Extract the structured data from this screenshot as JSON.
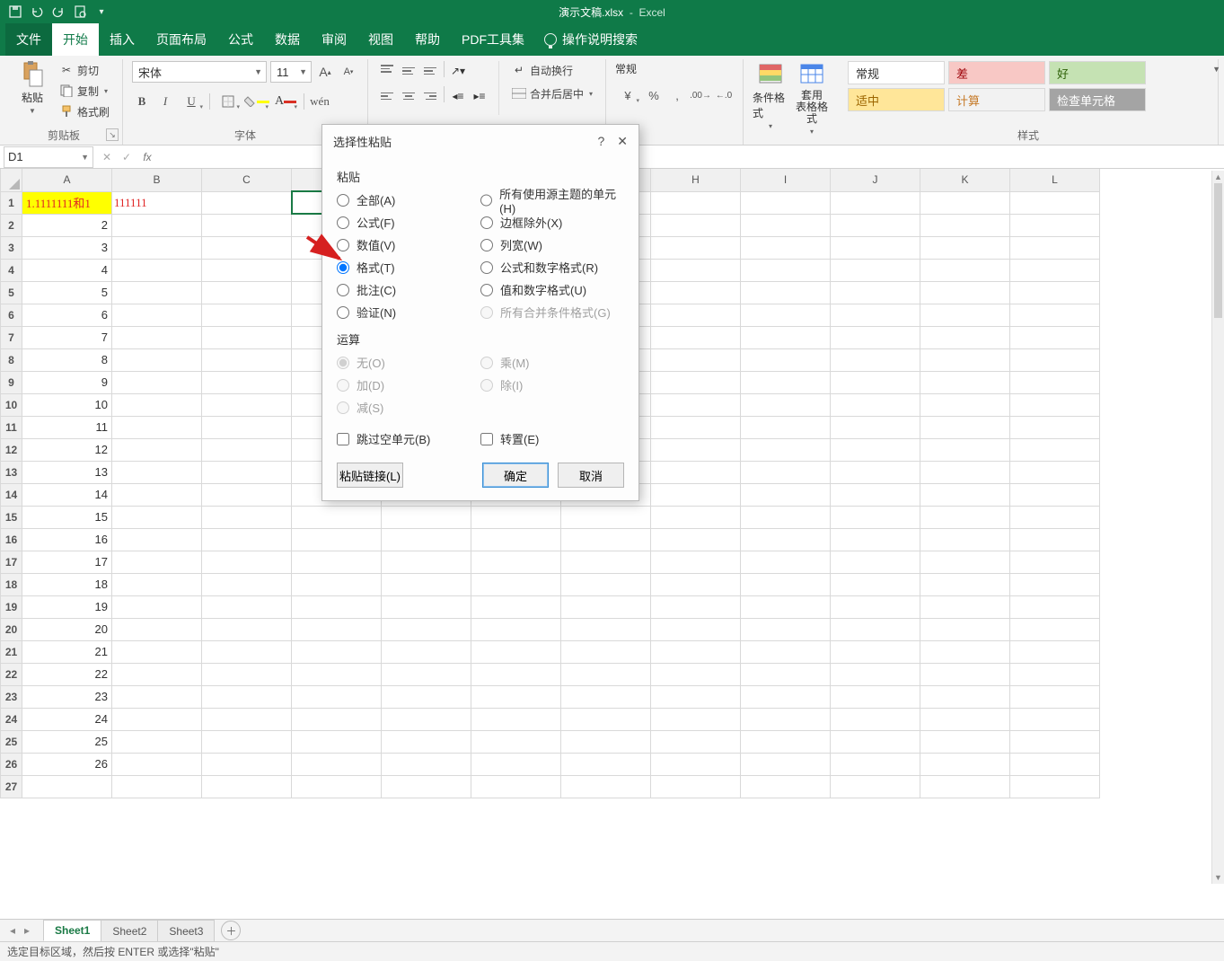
{
  "title": {
    "doc": "演示文稿.xlsx",
    "app": "Excel"
  },
  "qat": {
    "save": "保存",
    "undo": "撤销",
    "redo": "重做",
    "print": "打印预览",
    "custom": "自定义"
  },
  "menu": {
    "file": "文件",
    "home": "开始",
    "insert": "插入",
    "pagelayout": "页面布局",
    "formulas": "公式",
    "data": "数据",
    "review": "审阅",
    "view": "视图",
    "help": "帮助",
    "pdf": "PDF工具集",
    "tell": "操作说明搜索"
  },
  "ribbon": {
    "clipboard": {
      "label": "剪贴板",
      "paste": "粘贴",
      "cut": "剪切",
      "copy": "复制",
      "formatpainter": "格式刷"
    },
    "font": {
      "label": "字体",
      "name": "宋体",
      "size": "11"
    },
    "align": {
      "label": "",
      "wrap": "自动换行",
      "merge": "合并后居中"
    },
    "number": {
      "label": "",
      "format": "常规"
    },
    "cond": {
      "cf": "条件格式",
      "tablefmt": "套用\n表格格式"
    },
    "styles": {
      "label": "样式",
      "normal": "常规",
      "bad": "差",
      "good": "好",
      "neutral": "适中",
      "calc": "计算",
      "check": "检查单元格"
    }
  },
  "namebox": "D1",
  "cells": {
    "A1": "1.1111111和1",
    "B1": "111111",
    "A2": "2",
    "A3": "3",
    "A4": "4",
    "A5": "5",
    "A6": "6",
    "A7": "7",
    "A8": "8",
    "A9": "9",
    "A10": "10",
    "A11": "11",
    "A12": "12",
    "A13": "13",
    "A14": "14",
    "A15": "15",
    "A16": "16",
    "A17": "17",
    "A18": "18",
    "A19": "19",
    "A20": "20",
    "A21": "21",
    "A22": "22",
    "A23": "23",
    "A24": "24",
    "A25": "25",
    "A26": "26"
  },
  "columns": [
    "A",
    "B",
    "C",
    "D",
    "E",
    "F",
    "G",
    "H",
    "I",
    "J",
    "K",
    "L"
  ],
  "sheets": {
    "s1": "Sheet1",
    "s2": "Sheet2",
    "s3": "Sheet3"
  },
  "status": "选定目标区域，然后按 ENTER 或选择\"粘贴\"",
  "dialog": {
    "title": "选择性粘贴",
    "sect_paste": "粘贴",
    "all": "全部(A)",
    "formulas": "公式(F)",
    "values": "数值(V)",
    "formats": "格式(T)",
    "comments": "批注(C)",
    "validation": "验证(N)",
    "allsrc": "所有使用源主题的单元(H)",
    "noborder": "边框除外(X)",
    "colw": "列宽(W)",
    "fnumfmt": "公式和数字格式(R)",
    "vnumfmt": "值和数字格式(U)",
    "allcond": "所有合并条件格式(G)",
    "sect_op": "运算",
    "none": "无(O)",
    "add": "加(D)",
    "sub": "减(S)",
    "mul": "乘(M)",
    "div": "除(I)",
    "skip": "跳过空单元(B)",
    "transpose": "转置(E)",
    "pastelink": "粘贴链接(L)",
    "ok": "确定",
    "cancel": "取消"
  }
}
